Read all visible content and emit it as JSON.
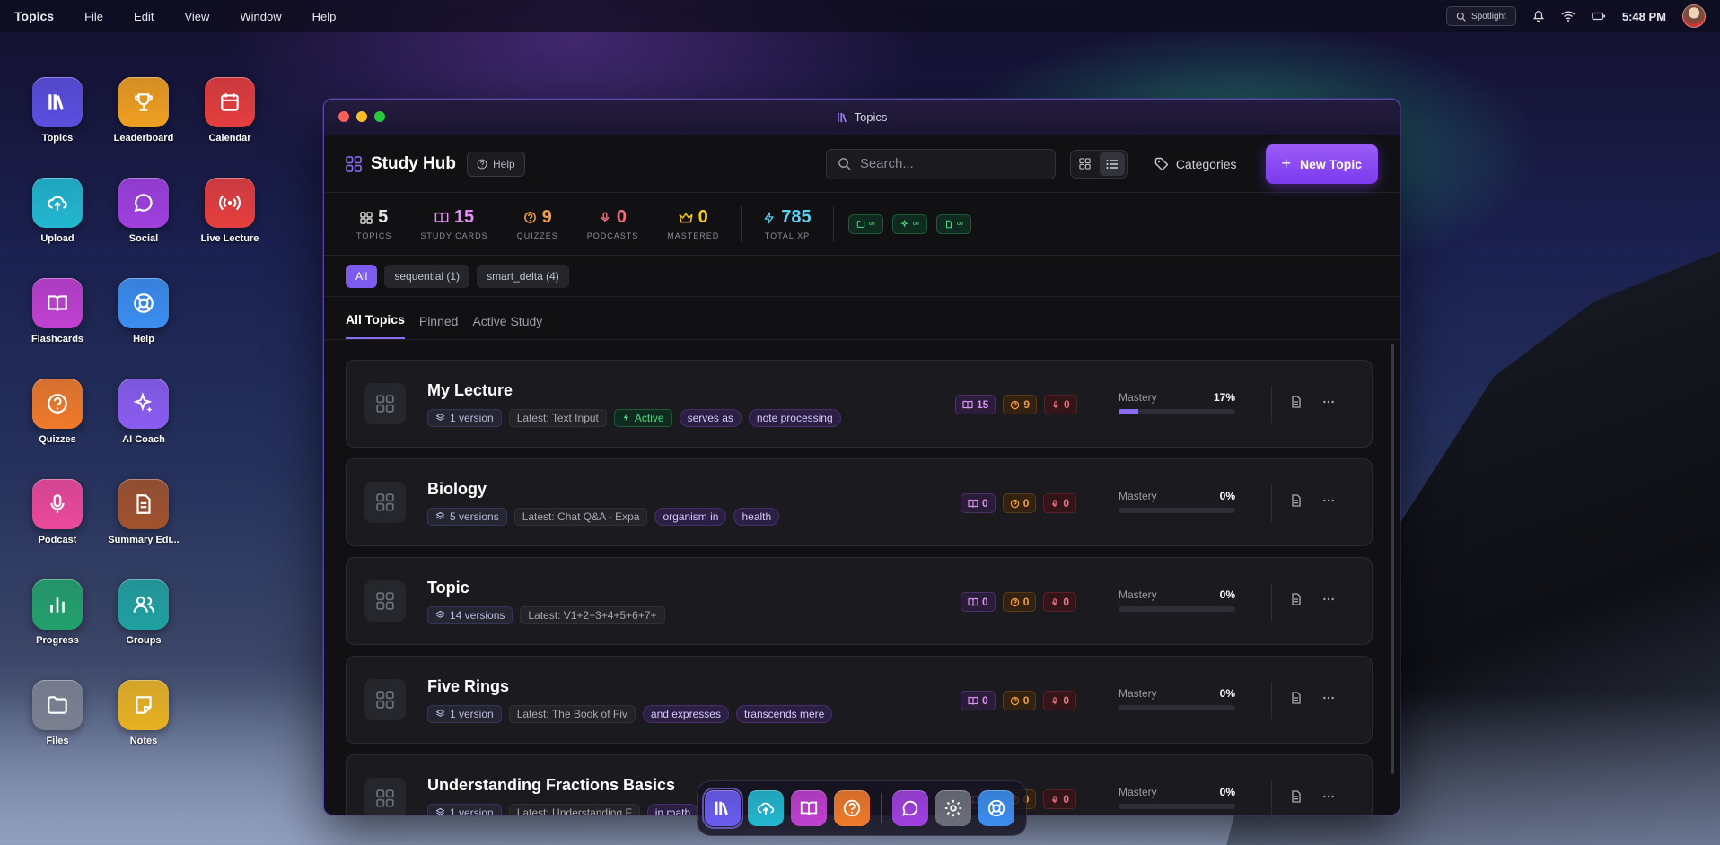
{
  "menubar": {
    "app_name": "Topics",
    "menus": [
      "File",
      "Edit",
      "View",
      "Window",
      "Help"
    ],
    "spotlight": "Spotlight",
    "time": "5:48 PM"
  },
  "desktop_icons": [
    {
      "label": "Topics",
      "icon": "library-icon",
      "color": "#5b4fe0"
    },
    {
      "label": "Leaderboard",
      "icon": "trophy-icon",
      "color": "#f0a020"
    },
    {
      "label": "Calendar",
      "icon": "calendar-icon",
      "color": "#e53e3e"
    },
    {
      "label": "Upload",
      "icon": "upload-cloud-icon",
      "color": "#22b8d0"
    },
    {
      "label": "Social",
      "icon": "chat-bubble-icon",
      "color": "#a040e0"
    },
    {
      "label": "Live Lecture",
      "icon": "broadcast-icon",
      "color": "#e53e3e"
    },
    {
      "label": "Flashcards",
      "icon": "open-book-icon",
      "color": "#c040d0"
    },
    {
      "label": "Help",
      "icon": "lifebuoy-icon",
      "color": "#3b8ef0"
    },
    {
      "label": "Quizzes",
      "icon": "question-circle-icon",
      "color": "#f07a2a"
    },
    {
      "label": "AI Coach",
      "icon": "sparkles-icon",
      "color": "#8a5cf0"
    },
    {
      "label": "Podcast",
      "icon": "microphone-icon",
      "color": "#ec4899"
    },
    {
      "label": "Summary Edi...",
      "icon": "document-icon",
      "color": "#a0522d"
    },
    {
      "label": "Progress",
      "icon": "bar-chart-icon",
      "color": "#22a06b"
    },
    {
      "label": "Groups",
      "icon": "users-icon",
      "color": "#20a0a0"
    },
    {
      "label": "Files",
      "icon": "folder-icon",
      "color": "#7a8090"
    },
    {
      "label": "Notes",
      "icon": "note-icon",
      "color": "#e8b020"
    }
  ],
  "window": {
    "title": "Topics"
  },
  "header": {
    "title": "Study Hub",
    "help_label": "Help",
    "search_placeholder": "Search...",
    "categories_label": "Categories",
    "new_topic_label": "New Topic"
  },
  "stats": [
    {
      "value": "5",
      "label": "TOPICS",
      "color": "#e6e6ea",
      "icon": "grid-icon"
    },
    {
      "value": "15",
      "label": "STUDY CARDS",
      "color": "#e090f0",
      "icon": "book-icon"
    },
    {
      "value": "9",
      "label": "QUIZZES",
      "color": "#f59e42",
      "icon": "quiz-icon"
    },
    {
      "value": "0",
      "label": "PODCASTS",
      "color": "#f07080",
      "icon": "mic-icon"
    },
    {
      "value": "0",
      "label": "MASTERED",
      "color": "#facc15",
      "icon": "crown-icon"
    },
    {
      "value": "785",
      "label": "TOTAL XP",
      "color": "#5fd0f0",
      "icon": "lightning-icon"
    }
  ],
  "mini_pills": [
    "∞",
    "∞",
    "∞"
  ],
  "filters": [
    "All",
    "sequential (1)",
    "smart_delta (4)"
  ],
  "tabs": [
    "All Topics",
    "Pinned",
    "Active Study"
  ],
  "mastery_label": "Mastery",
  "topics": [
    {
      "title": "My Lecture",
      "version": "1 version",
      "latest": "Latest: Text Input",
      "status": "Active",
      "keywords": [
        "serves as",
        "note processing"
      ],
      "cards": "15",
      "quizzes": "9",
      "podcasts": "0",
      "mastery": "17%",
      "mastery_fraction": 0.17
    },
    {
      "title": "Biology",
      "version": "5 versions",
      "latest": "Latest: Chat Q&A - Expa",
      "status": "",
      "keywords": [
        "organism in",
        "health"
      ],
      "cards": "0",
      "quizzes": "0",
      "podcasts": "0",
      "mastery": "0%",
      "mastery_fraction": 0
    },
    {
      "title": "Topic",
      "version": "14 versions",
      "latest": "Latest: V1+2+3+4+5+6+7+",
      "status": "",
      "keywords": [],
      "cards": "0",
      "quizzes": "0",
      "podcasts": "0",
      "mastery": "0%",
      "mastery_fraction": 0
    },
    {
      "title": "Five Rings",
      "version": "1 version",
      "latest": "Latest: The Book of Fiv",
      "status": "",
      "keywords": [
        "and expresses",
        "transcends mere"
      ],
      "cards": "0",
      "quizzes": "0",
      "podcasts": "0",
      "mastery": "0%",
      "mastery_fraction": 0
    },
    {
      "title": "Understanding Fractions Basics",
      "version": "1 version",
      "latest": "Latest: Understanding F",
      "status": "",
      "keywords": [
        "in math"
      ],
      "cards": "0",
      "quizzes": "0",
      "podcasts": "0",
      "mastery": "0%",
      "mastery_fraction": 0
    }
  ],
  "dock": [
    {
      "icon": "library-icon",
      "color": "#6a5cf0"
    },
    {
      "icon": "upload-cloud-icon",
      "color": "#22b8d0"
    },
    {
      "icon": "open-book-icon",
      "color": "#c040d0"
    },
    {
      "icon": "question-circle-icon",
      "color": "#f07a2a"
    },
    {
      "icon": "chat-bubble-icon",
      "color": "#a040e0"
    },
    {
      "icon": "gear-icon",
      "color": "#6b6f7a"
    },
    {
      "icon": "lifebuoy-icon",
      "color": "#3b8ef0"
    }
  ]
}
